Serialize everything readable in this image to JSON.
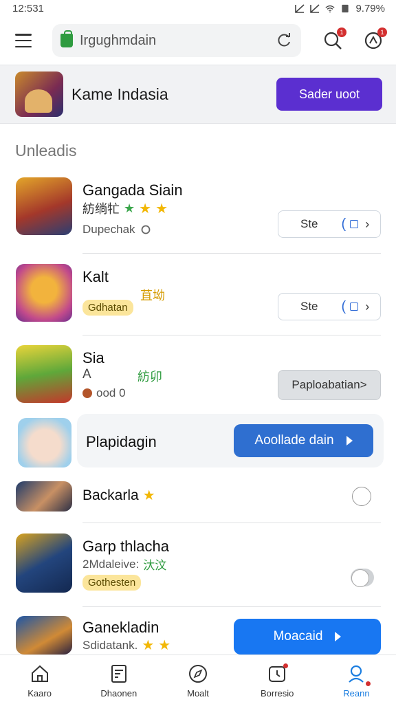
{
  "status_bar": {
    "time": "12:531",
    "battery": "9.79%"
  },
  "toolbar": {
    "search_text": "Irgughmdain",
    "notif_badge": "1",
    "alert_badge": "1"
  },
  "banner": {
    "title": "Kame Indasia",
    "button_label": "Sader uoot"
  },
  "section": {
    "title": "Unleadis"
  },
  "apps": [
    {
      "name": "Gangada Siain",
      "tag": "紡绱牤",
      "sub": "Dupechak",
      "button": "Ste"
    },
    {
      "name": "Kalt",
      "tag": "苴坳",
      "pill": "Gdhatan",
      "button": "Ste"
    },
    {
      "name": "Sia",
      "letter": "A",
      "tag": "紡卯",
      "sub": "ood 0",
      "button": "Paploabatian>"
    },
    {
      "name": "Plapidagin",
      "button": "Aoollade dain"
    },
    {
      "name": "Backarla"
    },
    {
      "name": "Garp thlacha",
      "sub": "2Mdaleive:",
      "tag": "汏汶",
      "pill": "Gothesten"
    },
    {
      "name": "Ganekladin",
      "sub": "Sdidatank.",
      "button": "Moacaid"
    }
  ],
  "bottom_nav": [
    {
      "label": "Kaaro"
    },
    {
      "label": "Dhaonen"
    },
    {
      "label": "Moalt"
    },
    {
      "label": "Borresio"
    },
    {
      "label": "Reann"
    }
  ],
  "colors": {
    "accent_purple": "#5b2fd0",
    "accent_blue": "#2f6fd0",
    "bright_blue": "#1877f2",
    "active_nav": "#1a7de0"
  }
}
